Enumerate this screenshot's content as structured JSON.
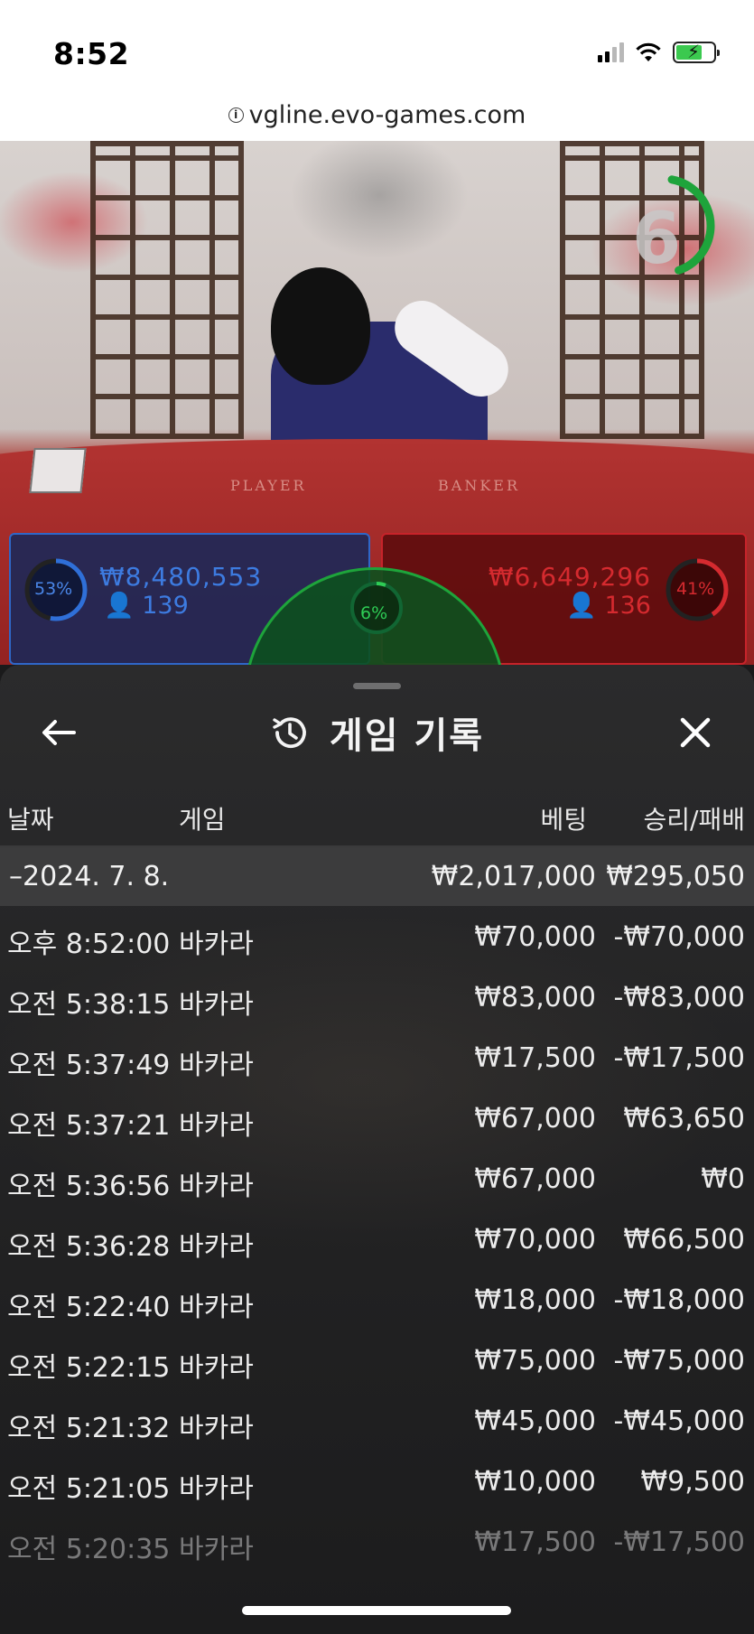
{
  "status_bar": {
    "time": "8:52"
  },
  "browser": {
    "url": "vgline.evo-games.com"
  },
  "video": {
    "countdown": "6",
    "table_labels": [
      "PLAYER",
      "BANKER"
    ]
  },
  "bets": {
    "player": {
      "percent": "53%",
      "amount": "₩8,480,553",
      "count": "139",
      "color": "#3d7be0",
      "fill": 0.53
    },
    "banker": {
      "percent": "41%",
      "amount": "₩6,649,296",
      "count": "136",
      "color": "#d52a2f",
      "fill": 0.41
    },
    "tie": {
      "percent": "6%",
      "color": "#1ea43b",
      "fill": 0.06
    }
  },
  "history": {
    "title": "게임 기록",
    "icons": {
      "back": "arrow-left-icon",
      "history": "history-icon",
      "close": "close-icon"
    },
    "columns": {
      "date": "날짜",
      "game": "게임",
      "bet": "베팅",
      "win_loss": "승리/패배"
    },
    "date_group": {
      "date": "–2024. 7. 8.",
      "bet_total": "₩2,017,000",
      "win_total": "₩295,050"
    },
    "rows": [
      {
        "time": "오후 8:52:00",
        "game": "바카라",
        "bet": "₩70,000",
        "result": "-₩70,000"
      },
      {
        "time": "오전 5:38:15",
        "game": "바카라",
        "bet": "₩83,000",
        "result": "-₩83,000"
      },
      {
        "time": "오전 5:37:49",
        "game": "바카라",
        "bet": "₩17,500",
        "result": "-₩17,500"
      },
      {
        "time": "오전 5:37:21",
        "game": "바카라",
        "bet": "₩67,000",
        "result": "₩63,650"
      },
      {
        "time": "오전 5:36:56",
        "game": "바카라",
        "bet": "₩67,000",
        "result": "₩0"
      },
      {
        "time": "오전 5:36:28",
        "game": "바카라",
        "bet": "₩70,000",
        "result": "₩66,500"
      },
      {
        "time": "오전 5:22:40",
        "game": "바카라",
        "bet": "₩18,000",
        "result": "-₩18,000"
      },
      {
        "time": "오전 5:22:15",
        "game": "바카라",
        "bet": "₩75,000",
        "result": "-₩75,000"
      },
      {
        "time": "오전 5:21:32",
        "game": "바카라",
        "bet": "₩45,000",
        "result": "-₩45,000"
      },
      {
        "time": "오전 5:21:05",
        "game": "바카라",
        "bet": "₩10,000",
        "result": "₩9,500"
      },
      {
        "time": "오전 5:20:35",
        "game": "바카라",
        "bet": "₩17,500",
        "result": "-₩17,500"
      }
    ]
  }
}
